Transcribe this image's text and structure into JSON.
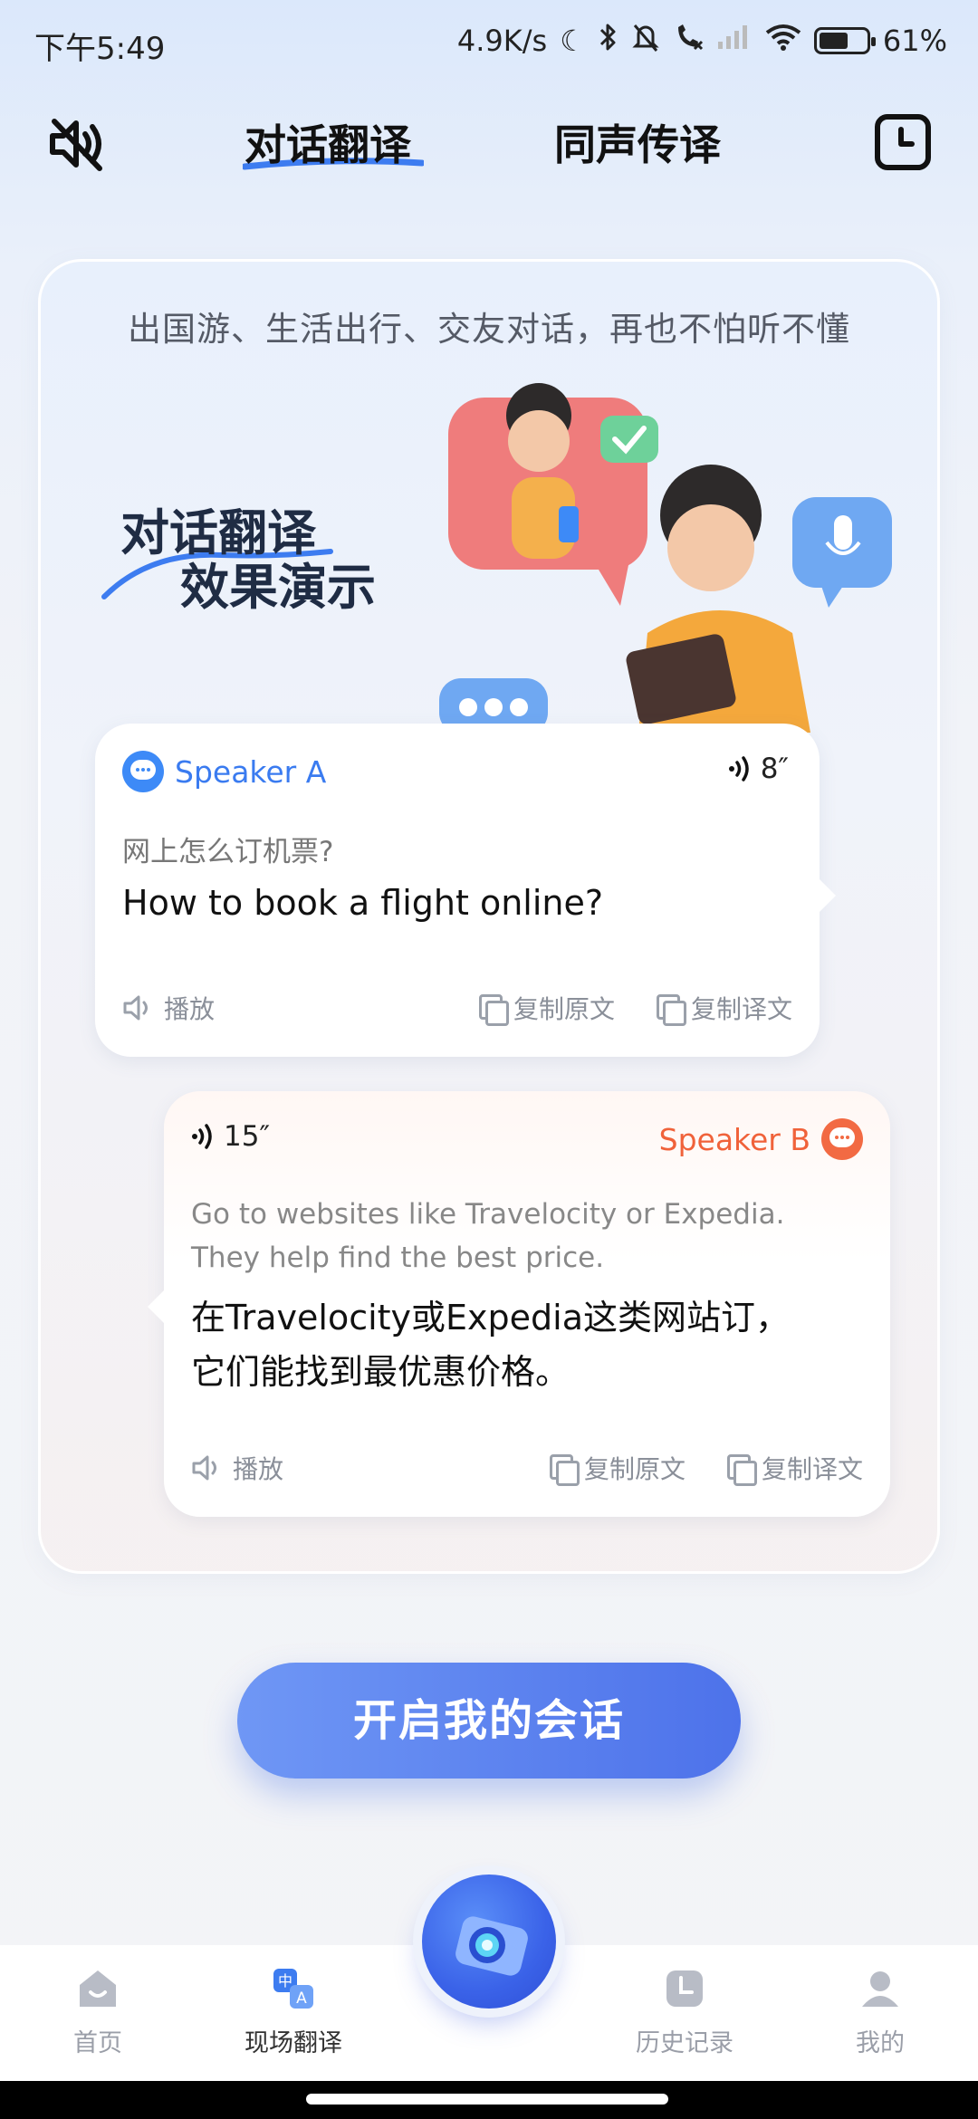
{
  "status_bar": {
    "time": "下午5:49",
    "net_speed": "4.9K/s",
    "battery": "61%",
    "battery_level": 0.61
  },
  "header": {
    "tabs": [
      {
        "label": "对话翻译",
        "active": true
      },
      {
        "label": "同声传译",
        "active": false
      }
    ]
  },
  "intro": {
    "tagline": "出国游、生活出行、交友对话，再也不怕听不懂",
    "demo_title_line1": "对话翻译",
    "demo_title_line2": "效果演示"
  },
  "speaker_a": {
    "name": "Speaker A",
    "duration": "8″",
    "source": "网上怎么订机票?",
    "translation": "How to book a flight online?",
    "play_label": "播放",
    "copy_source_label": "复制原文",
    "copy_translation_label": "复制译文"
  },
  "speaker_b": {
    "name": "Speaker B",
    "duration": "15″",
    "source": "Go to websites like Travelocity or Expedia. They help find the best price.",
    "translation_line1": "在Travelocity或Expedia这类网站订，",
    "translation_line2": "它们能找到最优惠价格。",
    "play_label": "播放",
    "copy_source_label": "复制原文",
    "copy_translation_label": "复制译文"
  },
  "cta": {
    "label": "开启我的会话"
  },
  "bottom_nav": {
    "items": [
      {
        "label": "首页",
        "icon": "home-icon",
        "active": false
      },
      {
        "label": "现场翻译",
        "icon": "translate-icon",
        "active": true
      },
      {
        "label": "历史记录",
        "icon": "history-icon",
        "active": false
      },
      {
        "label": "我的",
        "icon": "profile-icon",
        "active": false
      }
    ],
    "center_button_icon": "camera-icon"
  },
  "colors": {
    "accent_blue": "#3a7bf0",
    "speaker_b_orange": "#f0623a",
    "cta_gradient_start": "#6f97f5",
    "cta_gradient_end": "#4d72ea"
  }
}
